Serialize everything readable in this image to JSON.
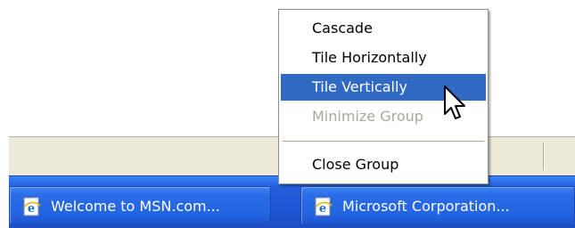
{
  "taskbar": {
    "buttons": [
      {
        "label": "Welcome to MSN.com...",
        "icon": "ie-page-icon"
      },
      {
        "label": "Microsoft Corporation...",
        "icon": "ie-page-icon"
      }
    ]
  },
  "context_menu": {
    "items": [
      {
        "label": "Cascade",
        "state": "normal"
      },
      {
        "label": "Tile Horizontally",
        "state": "normal"
      },
      {
        "label": "Tile Vertically",
        "state": "highlighted"
      },
      {
        "label": "Minimize Group",
        "state": "disabled"
      },
      {
        "label": "Close Group",
        "state": "normal"
      }
    ]
  },
  "colors": {
    "taskbar_blue": "#245edb",
    "menu_highlight": "#316ac5",
    "disabled_text": "#aca899",
    "status_bar": "#ece9d8"
  }
}
